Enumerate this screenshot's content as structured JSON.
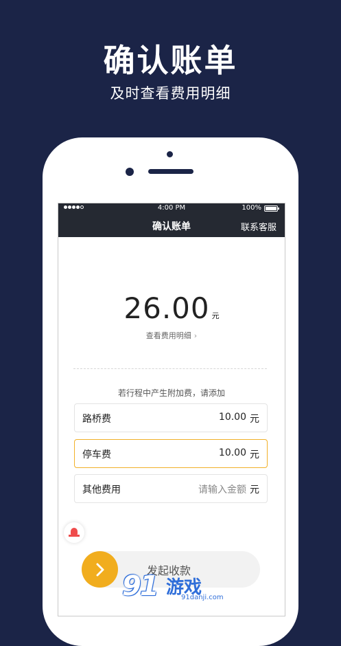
{
  "promo": {
    "title": "确认账单",
    "subtitle": "及时查看费用明细"
  },
  "statusbar": {
    "time": "4:00 PM",
    "battery": "100%"
  },
  "navbar": {
    "title": "确认账单",
    "action": "联系客服"
  },
  "bill": {
    "amount": "26.00",
    "unit": "元",
    "detail_link": "查看费用明细"
  },
  "extra_fees": {
    "hint": "若行程中产生附加费，请添加",
    "items": [
      {
        "label": "路桥费",
        "value": "10.00",
        "unit": "元"
      },
      {
        "label": "停车费",
        "value": "10.00",
        "unit": "元"
      },
      {
        "label": "其他费用",
        "placeholder": "请输入金额",
        "unit": "元"
      }
    ]
  },
  "slider": {
    "label": "发起收款"
  },
  "watermark": {
    "brand": "游戏",
    "number": "91",
    "domain": "91danji.com"
  },
  "colors": {
    "background": "#1b2447",
    "accent": "#f1ad1e",
    "alarm": "#ef4c4c",
    "watermark": "#2f6ed9"
  },
  "icons": [
    "signal-icon",
    "battery-icon",
    "chevron-right-icon",
    "alarm-icon",
    "arrow-right-icon"
  ]
}
